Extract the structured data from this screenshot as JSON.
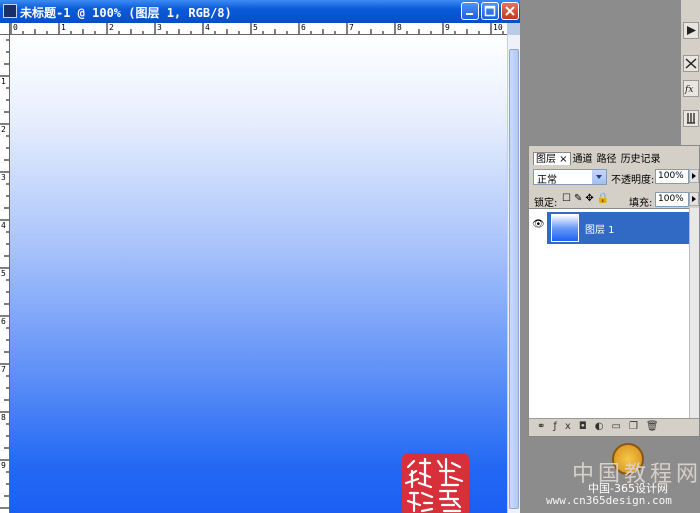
{
  "document": {
    "title": "未标题-1 @ 100% (图层 1, RGB/8)",
    "ruler_top_numbers": [
      "0",
      "1",
      "2",
      "3",
      "4",
      "5",
      "6",
      "7",
      "8",
      "9",
      "10"
    ],
    "ruler_left_numbers": [
      "1",
      "2",
      "3",
      "4",
      "5",
      "6",
      "7",
      "8",
      "9"
    ],
    "canvas_gradient": [
      "#ffffff",
      "#1a5ff2"
    ],
    "seal_color": "#d8303a"
  },
  "layers_panel": {
    "tabs": [
      "图层",
      "通道",
      "路径",
      "历史记录"
    ],
    "blend_mode": "正常",
    "opacity_label": "不透明度:",
    "opacity_value": "100%",
    "lock_label": "锁定:",
    "fill_label": "填充:",
    "fill_value": "100%",
    "layer_name": "图层 1"
  },
  "watermark": {
    "line1": "中国教程网",
    "line2": "中国-365设计网",
    "line3": "www.cn365design.com"
  },
  "colors": {
    "titlebar": "#0a5ad8",
    "selected_layer": "#316ac5"
  }
}
